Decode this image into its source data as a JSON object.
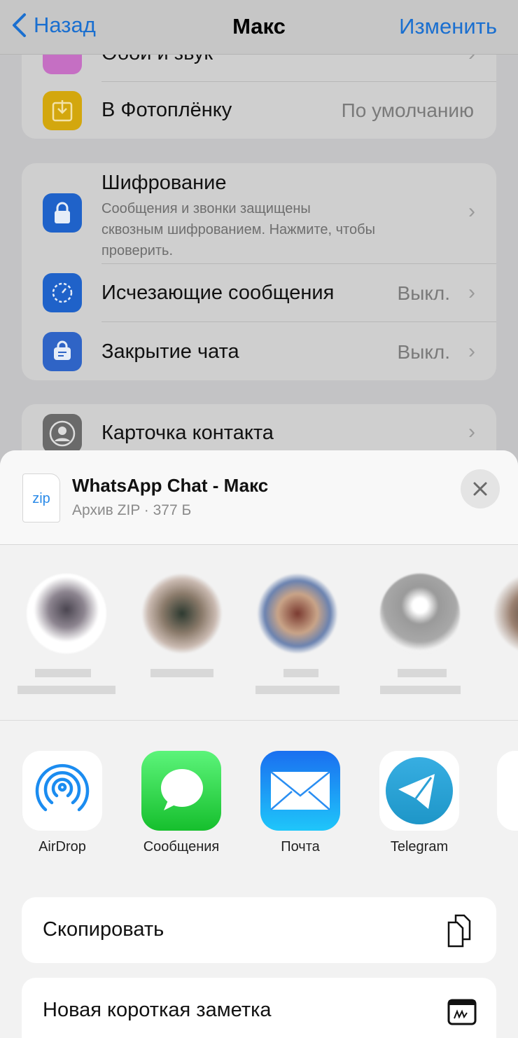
{
  "nav": {
    "back": "Назад",
    "title": "Макс",
    "edit": "Изменить"
  },
  "settings": {
    "wallpaper": "Обои и звук",
    "save_to_photos": {
      "label": "В Фотоплёнку",
      "value": "По умолчанию"
    },
    "encryption": {
      "label": "Шифрование",
      "desc1": "Сообщения и звонки защищены",
      "desc2": "сквозным шифрованием. Нажмите, чтобы",
      "desc3": "проверить."
    },
    "disappearing": {
      "label": "Исчезающие сообщения",
      "value": "Выкл."
    },
    "chat_lock": {
      "label": "Закрытие чата",
      "value": "Выкл."
    },
    "contact_card": {
      "label": "Карточка контакта"
    }
  },
  "share": {
    "file_icon": "zip",
    "file_name": "WhatsApp Chat - Макс",
    "file_meta": "Архив ZIP · 377 Б",
    "apps": [
      {
        "label": "AirDrop"
      },
      {
        "label": "Сообщения"
      },
      {
        "label": "Почта"
      },
      {
        "label": "Telegram"
      }
    ],
    "actions": [
      {
        "label": "Скопировать",
        "icon": "copy-icon"
      },
      {
        "label": "Новая короткая заметка",
        "icon": "quick-note-icon"
      }
    ]
  }
}
